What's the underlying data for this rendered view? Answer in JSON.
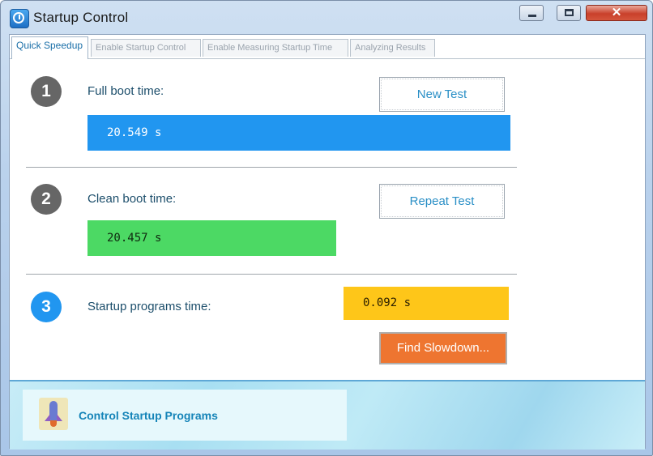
{
  "window": {
    "title": "Startup Control",
    "controls": {
      "minimize_icon": "minimize-icon",
      "maximize_icon": "maximize-icon",
      "close_glyph": "✕"
    }
  },
  "tabs": [
    {
      "label": "Quick Speedup",
      "active": true
    },
    {
      "label": "Enable Startup Control",
      "active": false
    },
    {
      "label": "Enable Measuring Startup Time",
      "active": false
    },
    {
      "label": "Analyzing Results",
      "active": false
    }
  ],
  "steps": [
    {
      "number": "1",
      "label": "Full boot time:",
      "value": "20.549 s",
      "button": "New Test",
      "circle_color": "#666666",
      "bar_color": "#2196f0"
    },
    {
      "number": "2",
      "label": "Clean boot time:",
      "value": "20.457 s",
      "button": "Repeat Test",
      "circle_color": "#666666",
      "bar_color": "#4cd964"
    },
    {
      "number": "3",
      "label": "Startup programs time:",
      "value": "0.092 s",
      "button": "Find Slowdown...",
      "circle_color": "#2196f0",
      "bar_color": "#fec619"
    }
  ],
  "footer": {
    "link_label": "Control Startup Programs",
    "icon": "rocket-icon"
  }
}
